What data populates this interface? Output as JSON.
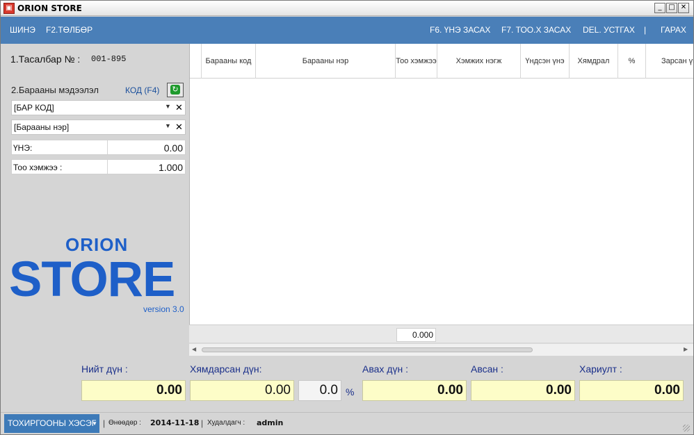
{
  "window": {
    "title": "ORION STORE",
    "icon": "app-icon"
  },
  "menu": {
    "new": "ШИНЭ",
    "payment": "F2.ТӨЛБӨР",
    "edit_price": "F6. ҮНЭ ЗАСАХ",
    "edit_qty": "F7. ТОО.Х ЗАСАХ",
    "delete": "DEL. УСТГАХ",
    "separator": "|",
    "exit": "ГАРАХ"
  },
  "receipt": {
    "label": "1.Тасалбар № :",
    "number": "001-895"
  },
  "product": {
    "label": "2.Барааны мэдээлэл",
    "code_link": "КОД (F4)",
    "barcode": "[БАР КОД]",
    "name": "[Барааны нэр]",
    "price_label": "ҮНЭ:",
    "price": "0.00",
    "qty_label": "Тоо хэмжээ :",
    "qty": "1.000"
  },
  "logo": {
    "top": "ORION",
    "main": "STORE",
    "version": "version 3.0"
  },
  "grid": {
    "columns": [
      "Барааны код",
      "Барааны нэр",
      "Тоо хэмжээ",
      "Хэмжих нэгж",
      "Үндсэн үнэ",
      "Хямдрал",
      "%",
      "Зарсан үнэ"
    ],
    "rows": [],
    "total_qty": "0.000"
  },
  "totals": {
    "total_label": "Нийт дүн :",
    "total": "0.00",
    "discounted_label": "Хямдарсан дүн:",
    "discounted": "0.00",
    "percent": "0.0",
    "percent_sign": "%",
    "payable_label": "Авах дүн :",
    "payable": "0.00",
    "received_label": "Авсан :",
    "received": "0.00",
    "change_label": "Хариулт :",
    "change": "0.00"
  },
  "status": {
    "settings": "ТОХИРГООНЫ ХЭСЭГ",
    "date_label": "Өнөөдөр :",
    "date": "2014-11-18",
    "seller_label": "Худалдагч :",
    "seller": "admin"
  },
  "colors": {
    "menubar": "#4a7fb8",
    "accent_text": "#1a2f8a",
    "logo": "#1e5fc8",
    "total_box": "#fdfdc8"
  }
}
